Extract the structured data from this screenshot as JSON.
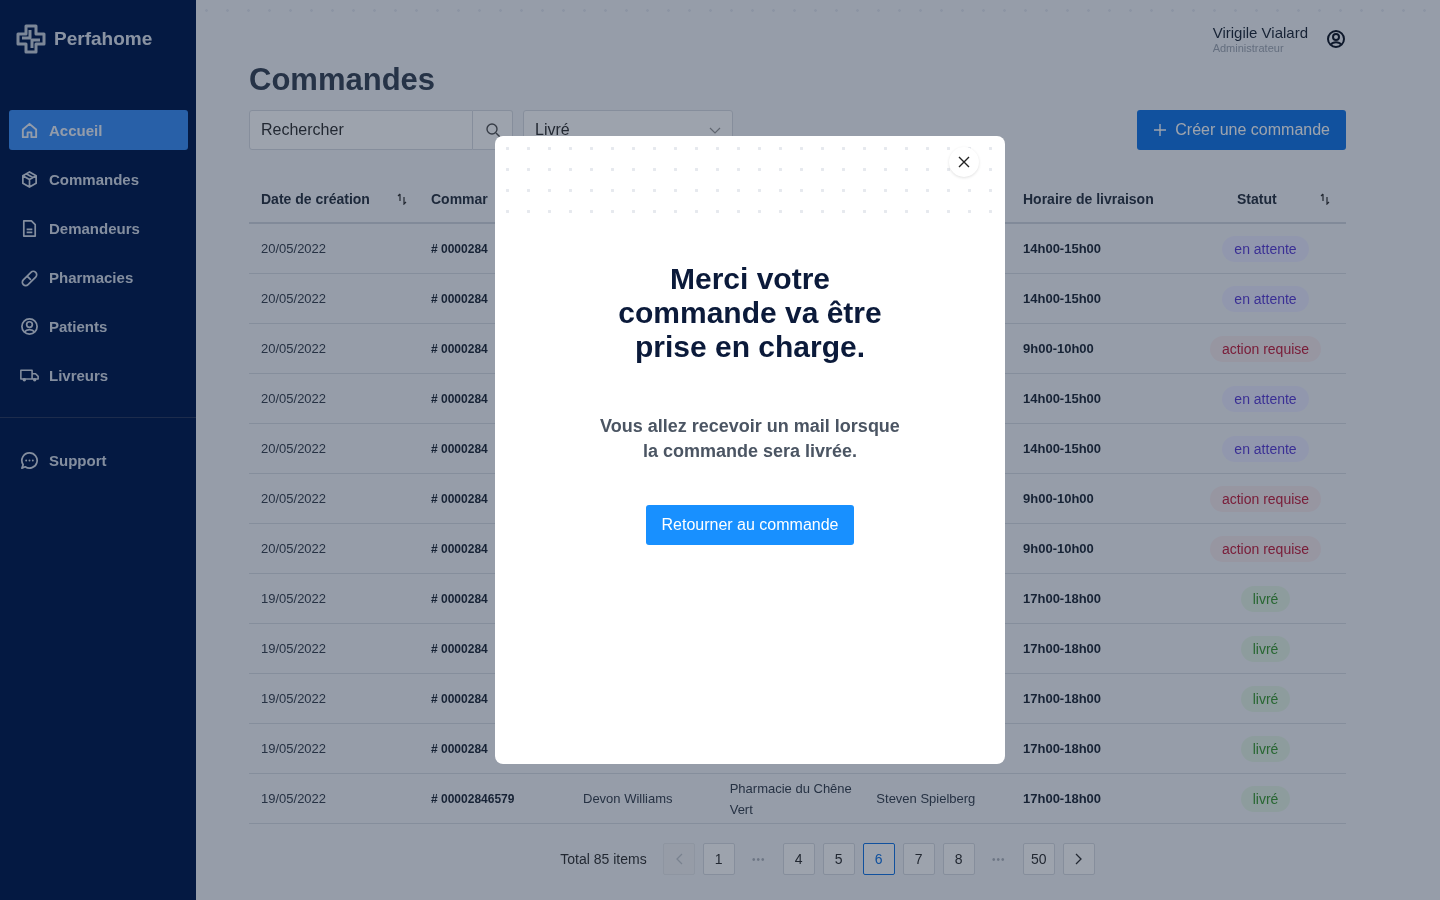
{
  "sidebar": {
    "brand": "Perfahome",
    "items": [
      {
        "label": "Accueil",
        "selected": true
      },
      {
        "label": "Commandes",
        "selected": false
      },
      {
        "label": "Demandeurs",
        "selected": false
      },
      {
        "label": "Pharmacies",
        "selected": false
      },
      {
        "label": "Patients",
        "selected": false
      },
      {
        "label": "Livreurs",
        "selected": false
      }
    ],
    "support_items": [
      {
        "label": "Support",
        "selected": false
      }
    ]
  },
  "user": {
    "name": "Virigile Vialard",
    "role": "Administrateur"
  },
  "page_title": "Commandes",
  "search": {
    "placeholder": "Rechercher"
  },
  "status_filter": {
    "value": "Livré"
  },
  "create_button": {
    "label": "Créer une commande"
  },
  "table": {
    "columns": [
      {
        "label": "Date de création",
        "sortable": true
      },
      {
        "label": "Commar",
        "sortable": false
      },
      {
        "label": "Horaire de livraison",
        "sortable": false
      },
      {
        "label": "Statut",
        "sortable": true
      }
    ],
    "rows": [
      {
        "date": "20/05/2022",
        "order": "# 0000284",
        "time": "14h00-15h00",
        "status": {
          "label": "en attente",
          "kind": "waiting"
        }
      },
      {
        "date": "20/05/2022",
        "order": "# 0000284",
        "time": "14h00-15h00",
        "status": {
          "label": "en attente",
          "kind": "waiting"
        }
      },
      {
        "date": "20/05/2022",
        "order": "# 0000284",
        "time": "9h00-10h00",
        "status": {
          "label": "action requise",
          "kind": "action"
        }
      },
      {
        "date": "20/05/2022",
        "order": "# 0000284",
        "time": "14h00-15h00",
        "status": {
          "label": "en attente",
          "kind": "waiting"
        }
      },
      {
        "date": "20/05/2022",
        "order": "# 0000284",
        "time": "14h00-15h00",
        "status": {
          "label": "en attente",
          "kind": "waiting"
        }
      },
      {
        "date": "20/05/2022",
        "order": "# 0000284",
        "time": "9h00-10h00",
        "status": {
          "label": "action requise",
          "kind": "action"
        }
      },
      {
        "date": "20/05/2022",
        "order": "# 0000284",
        "time": "9h00-10h00",
        "status": {
          "label": "action requise",
          "kind": "action"
        }
      },
      {
        "date": "19/05/2022",
        "order": "# 0000284",
        "time": "17h00-18h00",
        "status": {
          "label": "livré",
          "kind": "delivered"
        }
      },
      {
        "date": "19/05/2022",
        "order": "# 0000284",
        "time": "17h00-18h00",
        "status": {
          "label": "livré",
          "kind": "delivered"
        }
      },
      {
        "date": "19/05/2022",
        "order": "# 0000284",
        "time": "17h00-18h00",
        "status": {
          "label": "livré",
          "kind": "delivered"
        }
      },
      {
        "date": "19/05/2022",
        "order": "# 0000284",
        "time": "17h00-18h00",
        "status": {
          "label": "livré",
          "kind": "delivered"
        }
      },
      {
        "date": "19/05/2022",
        "order": "# 00002846579",
        "requester": "Devon Williams",
        "pharmacy": "Pharmacie du Chêne Vert",
        "courier": "Steven Spielberg",
        "time": "17h00-18h00",
        "status": {
          "label": "livré",
          "kind": "delivered"
        }
      }
    ]
  },
  "pagination": {
    "total": "Total 85 items",
    "items": [
      {
        "kind": "prev",
        "disabled": true
      },
      {
        "kind": "page",
        "label": "1",
        "selected": false
      },
      {
        "kind": "ellipsis",
        "label": "•••"
      },
      {
        "kind": "page",
        "label": "4",
        "selected": false
      },
      {
        "kind": "page",
        "label": "5",
        "selected": false
      },
      {
        "kind": "page",
        "label": "6",
        "selected": true
      },
      {
        "kind": "page",
        "label": "7",
        "selected": false
      },
      {
        "kind": "page",
        "label": "8",
        "selected": false
      },
      {
        "kind": "ellipsis",
        "label": "•••"
      },
      {
        "kind": "page",
        "label": "50",
        "selected": false
      },
      {
        "kind": "next",
        "disabled": false
      }
    ]
  },
  "modal": {
    "title": "Merci votre commande va être prise en charge.",
    "message": "Vous allez recevoir un mail lorsque la commande sera livrée.",
    "button": "Retourner au commande"
  }
}
